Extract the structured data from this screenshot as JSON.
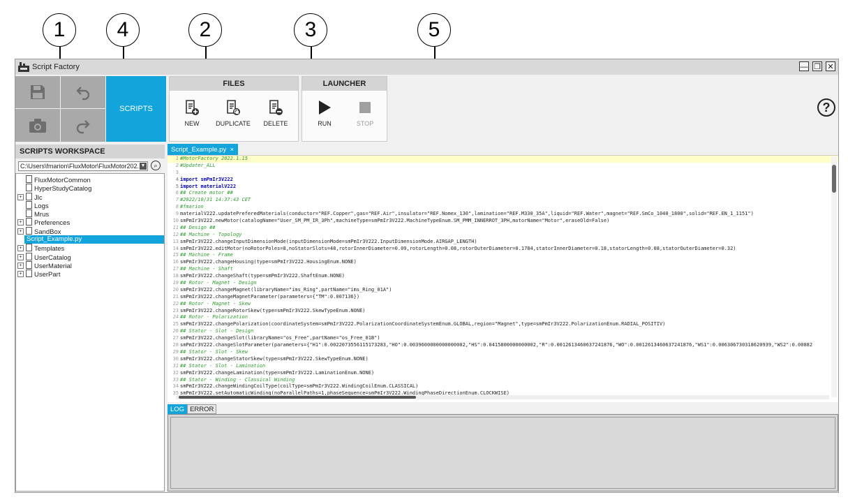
{
  "callouts": [
    "1",
    "4",
    "2",
    "3",
    "5"
  ],
  "window": {
    "title": "Script Factory",
    "controls": [
      "minimize-icon",
      "restore-icon",
      "close-icon"
    ]
  },
  "quick_access": {
    "icons": [
      "save-icon",
      "undo-icon",
      "snapshot-icon",
      "redo-icon"
    ]
  },
  "scripts_tab_label": "SCRIPTS",
  "files_group": {
    "title": "FILES",
    "buttons": [
      {
        "label": "NEW",
        "icon": "new-script-icon"
      },
      {
        "label": "DUPLICATE",
        "icon": "duplicate-script-icon"
      },
      {
        "label": "DELETE",
        "icon": "delete-script-icon"
      }
    ]
  },
  "launcher_group": {
    "title": "LAUNCHER",
    "buttons": [
      {
        "label": "RUN",
        "icon": "play-icon"
      },
      {
        "label": "STOP",
        "icon": "stop-icon"
      }
    ]
  },
  "help_icon": "help-icon",
  "workspace": {
    "title": "SCRIPTS WORKSPACE",
    "path": "C:\\Users\\fmarion\\FluxMotor\\FluxMotor202...",
    "tree": [
      {
        "label": "FluxMotorCommon",
        "expandable": false
      },
      {
        "label": "HyperStudyCatalog",
        "expandable": false
      },
      {
        "label": "Jlc",
        "expandable": true
      },
      {
        "label": "Logs",
        "expandable": false
      },
      {
        "label": "Mrus",
        "expandable": false
      },
      {
        "label": "Preferences",
        "expandable": true
      },
      {
        "label": "SandBox",
        "expandable": true
      },
      {
        "label": "Script_Example.py",
        "expandable": false,
        "selected": true
      },
      {
        "label": "Templates",
        "expandable": true
      },
      {
        "label": "UserCatalog",
        "expandable": true
      },
      {
        "label": "UserMaterial",
        "expandable": true
      },
      {
        "label": "UserPart",
        "expandable": true
      }
    ]
  },
  "editor": {
    "tab_label": "Script_Example.py",
    "tab_close": "×",
    "lines": [
      "#MotorFactory 2022.1.15",
      "#Updater_ALL",
      "",
      "import smPmIr3V222",
      "import materialV222",
      "## Create motor ##",
      "#2022/10/31 14:37:43 CET",
      "#fmarion",
      "materialV222.updatePreferedMaterials(conductor=\"REF.Copper\",gas=\"REF.Air\",insulator=\"REF.Nomex_130\",lamination=\"REF.M330_35A\",liquid=\"REF.Water\",magnet=\"REF.SmCo_1040_1800\",solid=\"REF.EN_1_1151\")",
      "smPmIr3V222.newMotor(catalogName=\"User_SM_PM_IR_3Ph\",machineType=smPmIr3V222.MachineTypeEnum.SM_PMM_INNERROT_3PH,motorName=\"Motor\",eraseOld=False)",
      "## Design ##",
      "## Machine - Topology",
      "smPmIr3V222.changeInputDimensionMode(inputDimensionMode=smPmIr3V222.InputDimensionMode.AIRGAP_LENGTH)",
      "smPmIr3V222.editMotor(noRotorPoles=8,noStatorSlots=48,rotorInnerDiameter=0.09,rotorLength=0.08,rotorOuterDiameter=0.1784,statorInnerDiameter=0.18,statorLength=0.08,statorOuterDiameter=0.32)",
      "## Machine - Frame",
      "smPmIr3V222.changeHousing(type=smPmIr3V222.HousingEnum.NONE)",
      "## Machine - Shaft",
      "smPmIr3V222.changeShaft(type=smPmIr3V222.ShaftEnum.NONE)",
      "## Rotor - Magnet - Design",
      "smPmIr3V222.changeMagnet(libraryName=\"ims_Ring\",partName=\"ims_Ring_01A\")",
      "smPmIr3V222.changeMagnetParameter(parameters={\"TM\":0.007136})",
      "## Rotor - Magnet - Skew",
      "smPmIr3V222.changeRotorSkew(type=smPmIr3V222.SkewTypeEnum.NONE)",
      "## Rotor - Polarization",
      "smPmIr3V222.changePolarization(coordinateSystem=smPmIr3V222.PolarizationCoordinateSystemEnum.GLOBAL,region=\"Magnet\",type=smPmIr3V222.PolarizationEnum.RADIAL_POSITIV)",
      "## Stator - Slot - Design",
      "smPmIr3V222.changeSlot(libraryName=\"os_Free\",partName=\"os_Free_01B\")",
      "smPmIr3V222.changeSlotParameter(parameters={\"H1\":0.0022073556115173283,\"HO\":0.0039600000000000002,\"HS\":0.0415800000000002,\"R\":0.0012613460637241876,\"WO\":0.0012613460637241876,\"WS1\":0.006306730318620939,\"WS2\":0.00882",
      "## Stator - Slot - Skew",
      "smPmIr3V222.changeStatorSkew(type=smPmIr3V222.SkewTypeEnum.NONE)",
      "## Stator - Slot - Lamination",
      "smPmIr3V222.changeLamination(type=smPmIr3V222.LaminationEnum.NONE)",
      "## Stator - Winding - Classical Winding",
      "smPmIr3V222.changeWindingCoilType(coilType=smPmIr3V222.WindingCoilEnum.CLASSICAL)",
      "smPmIr3V222.setAutomaticWinding(noParallelPaths=1,phaseSequence=smPmIr3V222.WindingPhaseDirectionEnum.CLOCKWISE)"
    ]
  },
  "log_tabs": [
    "LOG",
    "ERROR"
  ]
}
